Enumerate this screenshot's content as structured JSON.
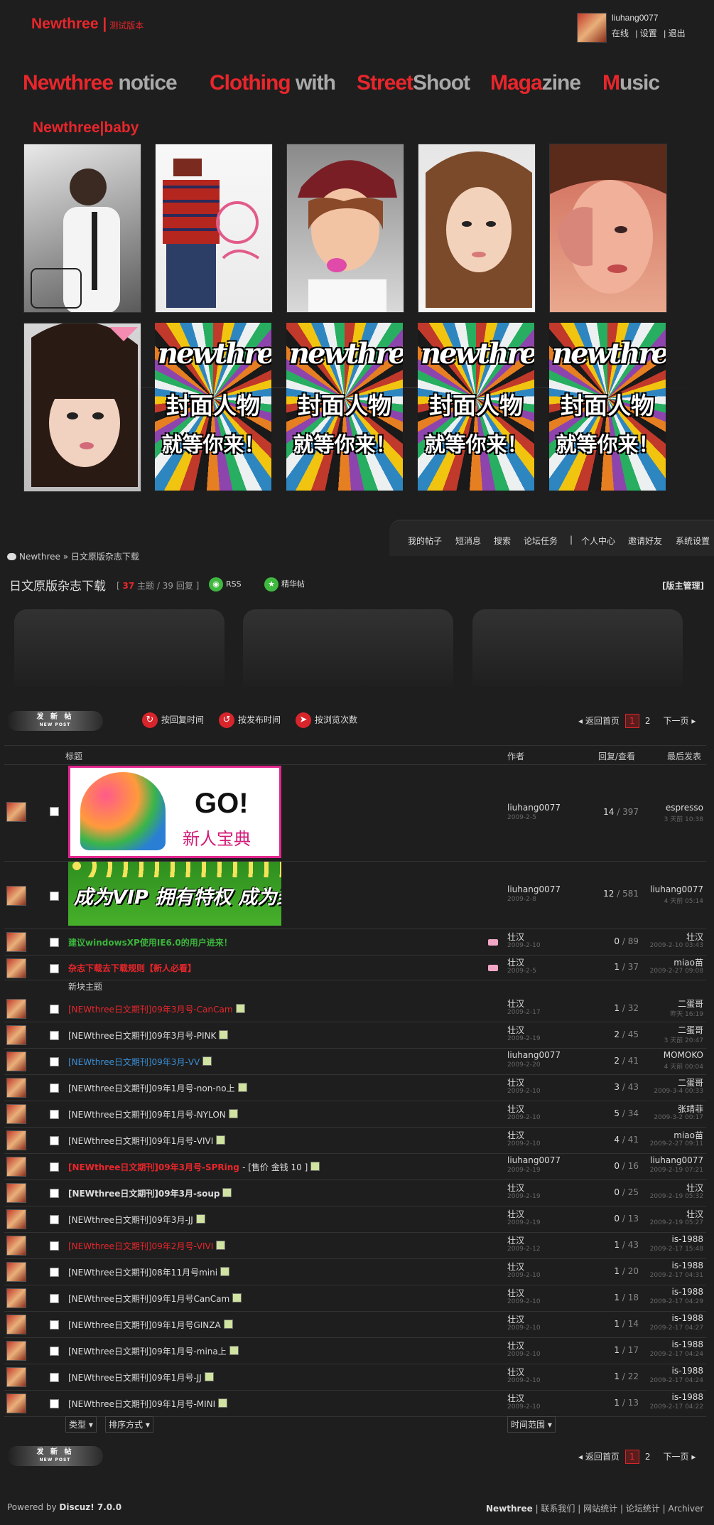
{
  "header": {
    "logo_text": "Newthree |",
    "logo_sub": "测试版本",
    "username": "liuhang0077",
    "user_links": [
      "在线",
      "| 设置",
      "| 退出"
    ]
  },
  "nav": {
    "items": [
      {
        "red": "Newthree",
        "gray": " notice"
      },
      {
        "red": "Clothing",
        "gray": " with"
      },
      {
        "red": "Street",
        "gray": "Shoot"
      },
      {
        "red": "Maga",
        "gray": "zine"
      },
      {
        "red": "M",
        "gray": "usic"
      }
    ]
  },
  "baby_title": "Newthree|baby",
  "cover": {
    "brand": "newthree",
    "line1": "封面人物",
    "line2": "就等你来！"
  },
  "subnav": {
    "items": [
      "我的帖子",
      "短消息",
      "搜索",
      "论坛任务",
      "|",
      "个人中心",
      "邀请好友",
      "系统设置"
    ]
  },
  "breadcrumb": {
    "home": "Newthree",
    "sep": "»",
    "current": "日文原版杂志下载"
  },
  "forum": {
    "title": "日文原版杂志下载",
    "topics_count": "37",
    "topics_label": "主题",
    "replies_text": "/ 39 回复",
    "rss_label": "RSS",
    "digest_label": "精华帖",
    "moderator": "[版主管理]"
  },
  "new_post": {
    "cn": "发 新 帖",
    "en": "NEW POST"
  },
  "sort": [
    {
      "label": "按回复时间"
    },
    {
      "label": "按发布时间"
    },
    {
      "label": "按浏览次数"
    }
  ],
  "pager": {
    "back": "返回首页",
    "current": "1",
    "page2": "2",
    "next": "下一页"
  },
  "table_header": {
    "title": "标题",
    "author": "作者",
    "replies_views": "回复/查看",
    "last_post": "最后发表"
  },
  "sticky": [
    {
      "banner": "banner1",
      "banner_go": "GO!",
      "banner_cn": "新人宝典",
      "author": "liuhang0077",
      "date": "2009-2-5",
      "replies": "14",
      "views": "397",
      "last": "espresso",
      "last_time": "3 天前 10:38"
    },
    {
      "banner": "banner2",
      "banner_text": "成为VIP 拥有特权 成为封面人物",
      "author": "liuhang0077",
      "date": "2009-2-8",
      "replies": "12",
      "views": "581",
      "last": "liuhang0077",
      "last_time": "4 天前 05:14"
    }
  ],
  "pinned": [
    {
      "title": "建议windowsXP使用IE6.0的用户进来！",
      "style": "green",
      "author": "壮汉",
      "date": "2009-2-10",
      "replies": "0",
      "views": "89",
      "last": "壮汉",
      "last_time": "2009-2-10 03:43"
    },
    {
      "title": "杂志下载去下载规则【新人必看】",
      "style": "redb",
      "author": "壮汉",
      "date": "2009-2-5",
      "replies": "1",
      "views": "37",
      "last": "miao苗",
      "last_time": "2009-2-27 09:08"
    }
  ],
  "section_label": "新块主题",
  "threads": [
    {
      "title": "[NEWthree日文期刊]09年3月号-CanCam",
      "style": "red",
      "author": "壮汉",
      "date": "2009-2-17",
      "replies": "1",
      "views": "32",
      "last": "二蛋哥",
      "last_time": "昨天 16:19"
    },
    {
      "title": "[NEWthree日文期刊]09年3月号-PINK",
      "style": "",
      "author": "壮汉",
      "date": "2009-2-19",
      "replies": "2",
      "views": "45",
      "last": "二蛋哥",
      "last_time": "3 天前 20:47"
    },
    {
      "title": "[NEWthree日文期刊]09年3月-VV",
      "style": "blue",
      "author": "liuhang0077",
      "date": "2009-2-20",
      "replies": "2",
      "views": "41",
      "last": "MOMOKO",
      "last_time": "4 天前 00:04"
    },
    {
      "title": "[NEWthree日文期刊]09年1月号-non-no上",
      "style": "",
      "author": "壮汉",
      "date": "2009-2-10",
      "replies": "3",
      "views": "43",
      "last": "二蛋哥",
      "last_time": "2009-3-4 00:33"
    },
    {
      "title": "[NEWthree日文期刊]09年1月号-NYLON",
      "style": "",
      "author": "壮汉",
      "date": "2009-2-10",
      "replies": "5",
      "views": "34",
      "last": "张靖菲",
      "last_time": "2009-3-2 00:17"
    },
    {
      "title": "[NEWthree日文期刊]09年1月号-VIVI",
      "style": "",
      "author": "壮汉",
      "date": "2009-2-10",
      "replies": "4",
      "views": "41",
      "last": "miao苗",
      "last_time": "2009-2-27 09:11"
    },
    {
      "title": "[NEWthree日文期刊]09年3月号-SPRing",
      "extra": "- [售价 金钱 10 ]",
      "style": "redb",
      "author": "liuhang0077",
      "date": "2009-2-19",
      "replies": "0",
      "views": "16",
      "last": "liuhang0077",
      "last_time": "2009-2-19 07:21"
    },
    {
      "title": "[NEWthree日文期刊]09年3月-soup",
      "style": "bold",
      "author": "壮汉",
      "date": "2009-2-19",
      "replies": "0",
      "views": "25",
      "last": "壮汉",
      "last_time": "2009-2-19 05:32"
    },
    {
      "title": "[NEWthree日文期刊]09年3月-JJ",
      "style": "",
      "author": "壮汉",
      "date": "2009-2-19",
      "replies": "0",
      "views": "13",
      "last": "壮汉",
      "last_time": "2009-2-19 05:27"
    },
    {
      "title": "[NEWthree日文期刊]09年2月号-VIVI",
      "style": "red",
      "author": "壮汉",
      "date": "2009-2-12",
      "replies": "1",
      "views": "43",
      "last": "is-1988",
      "last_time": "2009-2-17 15:48"
    },
    {
      "title": "[NEWthree日文期刊]08年11月号mini",
      "style": "",
      "author": "壮汉",
      "date": "2009-2-10",
      "replies": "1",
      "views": "20",
      "last": "is-1988",
      "last_time": "2009-2-17 04:31"
    },
    {
      "title": "[NEWthree日文期刊]09年1月号CanCam",
      "style": "",
      "author": "壮汉",
      "date": "2009-2-10",
      "replies": "1",
      "views": "18",
      "last": "is-1988",
      "last_time": "2009-2-17 04:29"
    },
    {
      "title": "[NEWthree日文期刊]09年1月号GINZA",
      "style": "",
      "author": "壮汉",
      "date": "2009-2-10",
      "replies": "1",
      "views": "14",
      "last": "is-1988",
      "last_time": "2009-2-17 04:27"
    },
    {
      "title": "[NEWthree日文期刊]09年1月号-mina上",
      "style": "",
      "author": "壮汉",
      "date": "2009-2-10",
      "replies": "1",
      "views": "17",
      "last": "is-1988",
      "last_time": "2009-2-17 04:24"
    },
    {
      "title": "[NEWthree日文期刊]09年1月号-JJ",
      "style": "",
      "author": "壮汉",
      "date": "2009-2-10",
      "replies": "1",
      "views": "22",
      "last": "is-1988",
      "last_time": "2009-2-17 04:24"
    },
    {
      "title": "[NEWthree日文期刊]09年1月号-MINI",
      "style": "",
      "author": "壮汉",
      "date": "2009-2-10",
      "replies": "1",
      "views": "13",
      "last": "is-1988",
      "last_time": "2009-2-17 04:22"
    }
  ],
  "filters": {
    "type": "类型",
    "sort": "排序方式",
    "time": "时间范围"
  },
  "footer": {
    "powered": "Powered by",
    "brand": "Discuz! 7.0.0",
    "links_brand": "Newthree",
    "links": [
      "| 联系我们",
      "| 网站统计",
      "| 论坛统计",
      "| Archiver"
    ]
  }
}
